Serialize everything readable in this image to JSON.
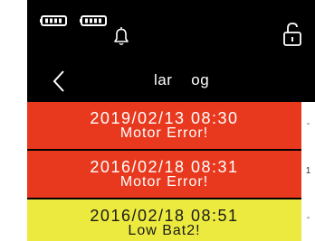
{
  "colors": {
    "screen_bg": "#000000",
    "error_row": "#e8391e",
    "warning_row": "#ecea3f",
    "text_light": "#ffffff",
    "text_dark": "#1a1a1a"
  },
  "statusbar": {
    "icons": [
      "battery-icon",
      "battery-icon",
      "bell-icon",
      "unlock-icon"
    ]
  },
  "navbar": {
    "back_icon": "chevron-left-icon",
    "title": "lar    og"
  },
  "alarm_log": {
    "rows": [
      {
        "datetime": "2019/02/13 08:30",
        "message": "Motor Error!",
        "color": "#e8391e"
      },
      {
        "datetime": "2016/02/18 08:31",
        "message": "Motor Error!",
        "color": "#e8391e"
      },
      {
        "datetime": "2016/02/18 08:51",
        "message": "Low Bat2!",
        "color": "#ecea3f"
      }
    ]
  },
  "side_marks": [
    "-",
    "1",
    "-"
  ]
}
